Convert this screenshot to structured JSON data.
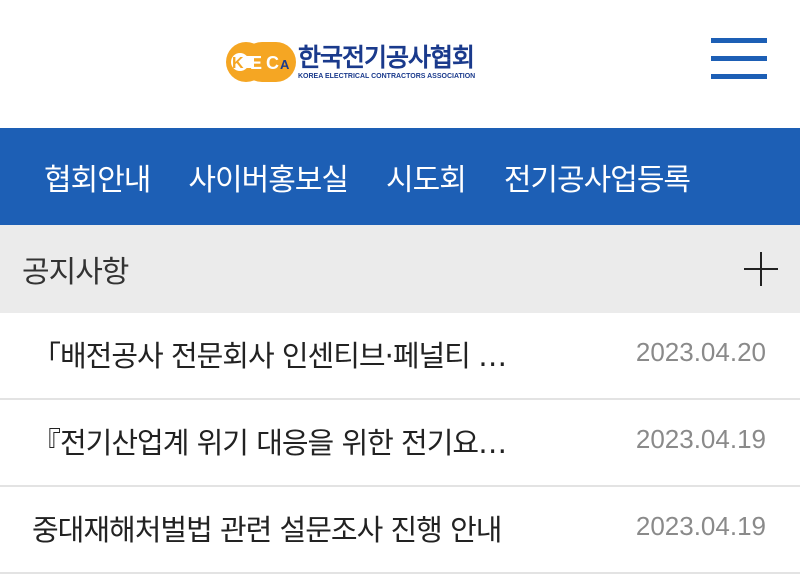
{
  "header": {
    "logo_ko": "한국전기공사협회",
    "logo_en": "KOREA ELECTRICAL CONTRACTORS ASSOCIATION",
    "logo_mark_text": "KECA",
    "menu_icon": "hamburger-menu-icon"
  },
  "nav": {
    "items": [
      {
        "label": "협회안내"
      },
      {
        "label": "사이버홍보실"
      },
      {
        "label": "시도회"
      },
      {
        "label": "전기공사업등록"
      }
    ]
  },
  "notice": {
    "title": "공지사항",
    "more_icon": "plus-icon",
    "items": [
      {
        "title": "「배전공사 전문회사 인센티브·페널티 …",
        "date": "2023.04.20"
      },
      {
        "title": "『전기산업계 위기 대응을 위한 전기요…",
        "date": "2023.04.19"
      },
      {
        "title": "중대재해처벌법 관련 설문조사 진행 안내",
        "date": "2023.04.19"
      }
    ]
  },
  "colors": {
    "brand_blue": "#1d5fb5",
    "logo_orange": "#f5a623",
    "logo_navy": "#1a3a8c",
    "section_bg": "#ebebeb"
  }
}
